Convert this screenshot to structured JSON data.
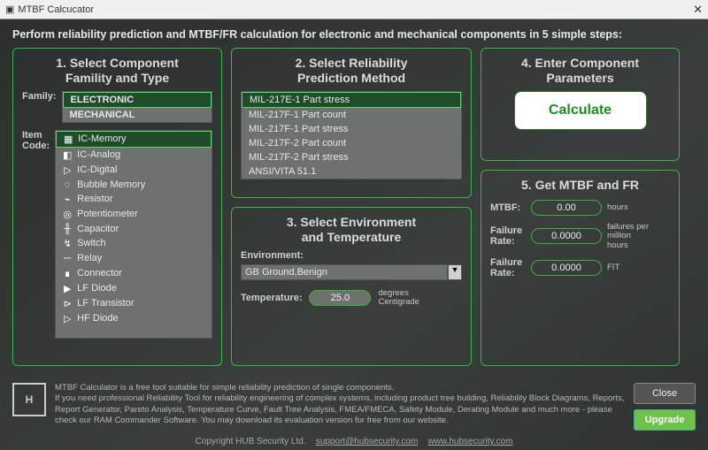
{
  "titlebar": {
    "title": "MTBF Calcucator"
  },
  "intro": "Perform reliability prediction and MTBF/FR calculation for electronic and mechanical components in 5 simple steps:",
  "panel1": {
    "title_l1": "1. Select Component",
    "title_l2": "Famility and Type",
    "family_label": "Family:",
    "families": [
      {
        "name": "ELECTRONIC",
        "selected": true
      },
      {
        "name": "MECHANICAL",
        "selected": false
      }
    ],
    "itemcode_label_l1": "Item",
    "itemcode_label_l2": "Code:",
    "items": [
      {
        "icon": "▦",
        "name": "IC-Memory",
        "selected": true
      },
      {
        "icon": "◧",
        "name": "IC-Analog"
      },
      {
        "icon": "▷",
        "name": "IC-Digital"
      },
      {
        "icon": "◌",
        "name": "Bubble Memory"
      },
      {
        "icon": "⌁",
        "name": "Resistor"
      },
      {
        "icon": "◎",
        "name": "Potentiometer"
      },
      {
        "icon": "╫",
        "name": "Capacitor"
      },
      {
        "icon": "↯",
        "name": "Switch"
      },
      {
        "icon": "⎓",
        "name": "Relay"
      },
      {
        "icon": "∎",
        "name": "Connector"
      },
      {
        "icon": "▶",
        "name": "LF Diode"
      },
      {
        "icon": "⊳",
        "name": "LF Transistor"
      },
      {
        "icon": "▷",
        "name": "HF Diode"
      }
    ]
  },
  "panel2": {
    "title_l1": "2. Select Reliability",
    "title_l2": "Prediction Method",
    "methods": [
      {
        "name": "MIL-217E-1 Part stress",
        "selected": true
      },
      {
        "name": "MIL-217F-1 Part count"
      },
      {
        "name": "MIL-217F-1 Part stress"
      },
      {
        "name": "MIL-217F-2 Part count"
      },
      {
        "name": "MIL-217F-2 Part stress"
      },
      {
        "name": "ANSI/VITA 51.1"
      }
    ]
  },
  "panel3": {
    "title_l1": "3. Select Environment",
    "title_l2": "and Temperature",
    "env_label": "Environment:",
    "env_value": "GB  Ground,Benign",
    "temp_label": "Temperature:",
    "temp_value": "25.0",
    "temp_unit_l1": "degrees",
    "temp_unit_l2": "Centigrade"
  },
  "panel4": {
    "title_l1": "4. Enter Component",
    "title_l2": "Parameters",
    "calc_button": "Calculate"
  },
  "panel5": {
    "title": "5. Get MTBF and FR",
    "mtbf_label": "MTBF:",
    "mtbf_value": "0.00",
    "mtbf_unit": "hours",
    "fr1_label_l1": "Failure",
    "fr1_label_l2": "Rate:",
    "fr1_value": "0.0000",
    "fr1_unit_l1": "failures per",
    "fr1_unit_l2": "million",
    "fr1_unit_l3": "hours",
    "fr2_label_l1": "Failure",
    "fr2_label_l2": "Rate:",
    "fr2_value": "0.0000",
    "fr2_unit": "FIT"
  },
  "footer": {
    "p1": "MTBF Calculator is a free tool suitable for simple reliability prediction of single components.",
    "p2": "If you need professional Reliability Tool for reliability engineering of complex systems, including product tree building, Reliability Block Diagrams, Reports, Report Generator, Pareto Analysis, Temperature Curve, Fault Tree Analysis, FMEA/FMECA, Safety Module, Derating Module and much more - please check our RAM Commander Software. You may download its evaluation version for free from our website.",
    "close": "Close",
    "upgrade": "Upgrade"
  },
  "copyright": {
    "text": "Copyright HUB Security  Ltd.",
    "email": "support@hubsecurity.com",
    "url": "www.hubsecurity.com"
  }
}
